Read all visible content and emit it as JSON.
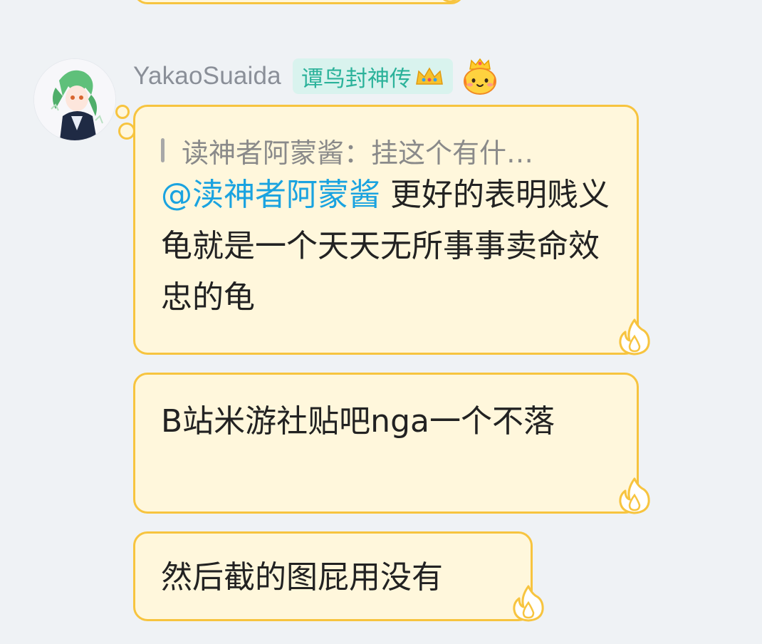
{
  "user": {
    "name": "YakaoSuaida",
    "title_badge": "谭鸟封神传"
  },
  "messages": [
    {
      "quote": "读神者阿蒙酱：挂这个有什…",
      "mention": "@渎神者阿蒙酱",
      "text": " 更好的表明贱义龟就是一个天天无所事事卖命效忠的龟"
    },
    {
      "text": "B站米游社贴吧nga一个不落"
    },
    {
      "text": "然后截的图屁用没有"
    }
  ],
  "colors": {
    "background": "#eff2f5",
    "bubble_fill": "#fff7dc",
    "bubble_border": "#f7c43f",
    "badge_bg": "#d9f3ee",
    "badge_text": "#2bb29a",
    "mention": "#1aa3e0"
  }
}
